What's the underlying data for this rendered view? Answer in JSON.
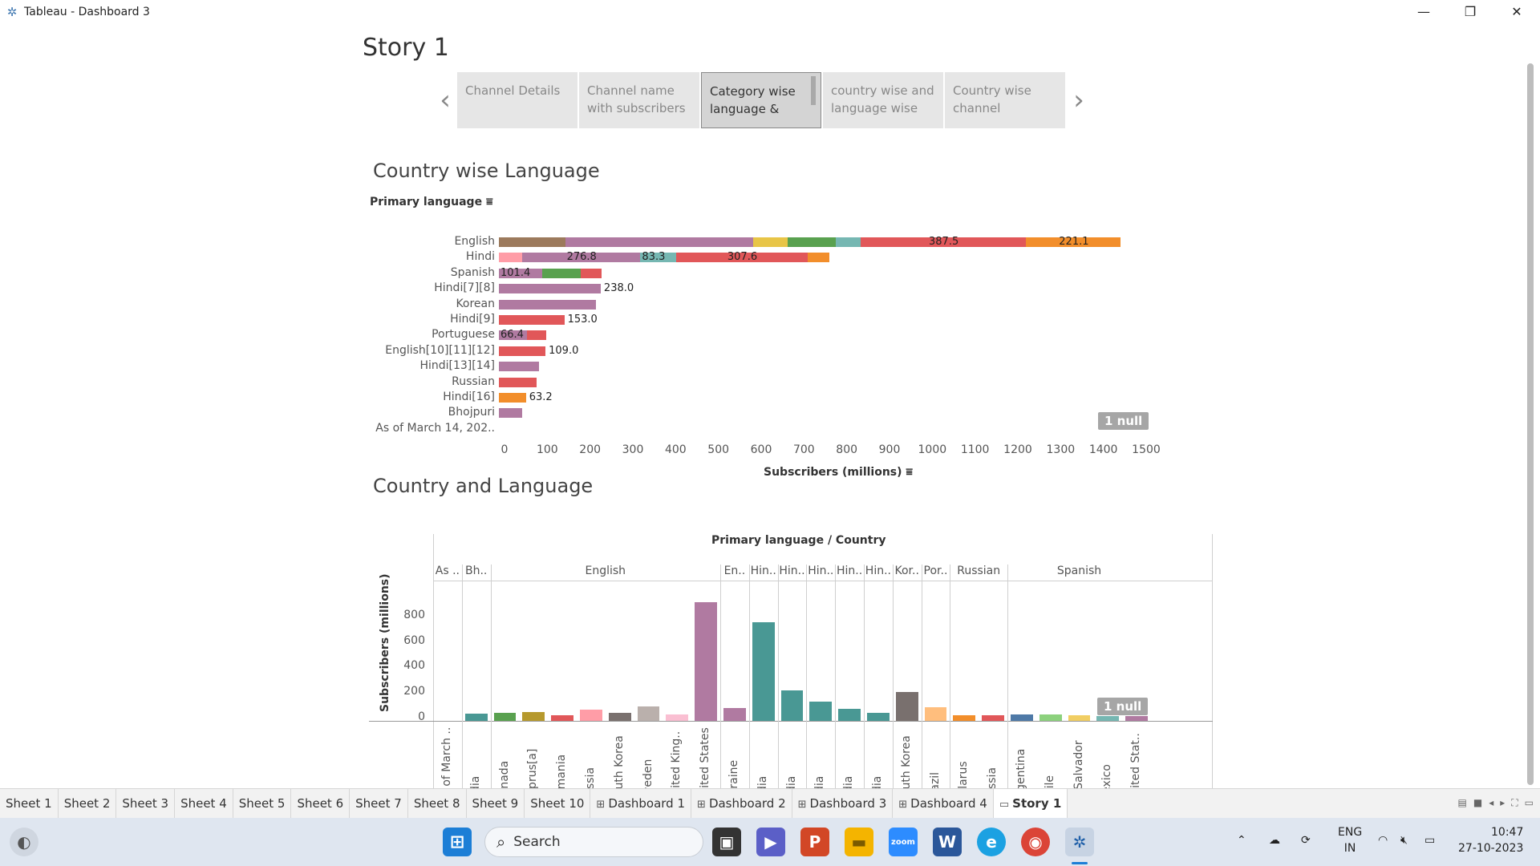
{
  "window": {
    "title": "Tableau - Dashboard 3",
    "minimize": "—",
    "maximize": "❐",
    "close": "✕"
  },
  "story": {
    "title": "Story 1",
    "points": [
      {
        "label": "Channel Details",
        "active": false
      },
      {
        "label": "Channel name with subscribers",
        "active": false
      },
      {
        "label": "Category wise language &",
        "active": true
      },
      {
        "label": "country wise and language wise",
        "active": false
      },
      {
        "label": "Country wise channel",
        "active": false
      }
    ]
  },
  "colors": {
    "brown": "#9c7a5c",
    "purple": "#b07aa1",
    "yellow": "#e8c547",
    "green": "#59a14f",
    "teal": "#76b7b2",
    "red": "#e15759",
    "orange": "#f28e2b",
    "pink": "#ff9da7",
    "dteal": "#499894",
    "gray": "#79706e",
    "lgray": "#bab0ac",
    "olive": "#b6992d",
    "lpink": "#fabfd2",
    "lorange": "#ffbe7d",
    "blue": "#4e79a7",
    "lgreen": "#8cd17d",
    "lyellow": "#f1ce63"
  },
  "chart_data": [
    {
      "type": "bar",
      "title": "Country wise Language",
      "ylabel": "Primary language",
      "xlabel": "Subscribers (millions)",
      "xlim": [
        0,
        1500
      ],
      "xticks": [
        0,
        100,
        200,
        300,
        400,
        500,
        600,
        700,
        800,
        900,
        1000,
        1100,
        1200,
        1300,
        1400,
        1500
      ],
      "null_badge": "1 null",
      "rows": [
        {
          "label": "English",
          "segments": [
            {
              "value": 155,
              "color": "brown"
            },
            {
              "value": 440,
              "color": "purple"
            },
            {
              "value": 80,
              "color": "yellow"
            },
            {
              "value": 112,
              "color": "green"
            },
            {
              "value": 58,
              "color": "teal"
            },
            {
              "value": 387.5,
              "color": "red",
              "label": "387.5"
            },
            {
              "value": 221.1,
              "color": "orange",
              "label": "221.1"
            }
          ]
        },
        {
          "label": "Hindi",
          "segments": [
            {
              "value": 54,
              "color": "pink"
            },
            {
              "value": 276.8,
              "color": "purple",
              "label": "276.8"
            },
            {
              "value": 83.3,
              "color": "teal",
              "label": "83.3"
            },
            {
              "value": 307.6,
              "color": "red",
              "label": "307.6"
            },
            {
              "value": 50,
              "color": "orange"
            }
          ]
        },
        {
          "label": "Spanish",
          "segments": [
            {
              "value": 101.4,
              "color": "purple",
              "label": "101.4"
            },
            {
              "value": 90,
              "color": "green"
            },
            {
              "value": 48,
              "color": "red"
            }
          ]
        },
        {
          "label": "Hindi[7][8]",
          "segments": [
            {
              "value": 238.0,
              "color": "purple"
            }
          ],
          "total_label": "238.0"
        },
        {
          "label": "Korean",
          "segments": [
            {
              "value": 226,
              "color": "purple"
            }
          ]
        },
        {
          "label": "Hindi[9]",
          "segments": [
            {
              "value": 153.0,
              "color": "red"
            }
          ],
          "total_label": "153.0"
        },
        {
          "label": "Portuguese",
          "segments": [
            {
              "value": 66.4,
              "color": "purple",
              "label": "66.4"
            },
            {
              "value": 44,
              "color": "red"
            }
          ]
        },
        {
          "label": "English[10][11][12]",
          "segments": [
            {
              "value": 109.0,
              "color": "red"
            }
          ],
          "total_label": "109.0"
        },
        {
          "label": "Hindi[13][14]",
          "segments": [
            {
              "value": 93,
              "color": "purple"
            }
          ]
        },
        {
          "label": "Russian",
          "segments": [
            {
              "value": 88,
              "color": "red"
            }
          ]
        },
        {
          "label": "Hindi[16]",
          "segments": [
            {
              "value": 63.2,
              "color": "orange"
            }
          ],
          "total_label": "63.2"
        },
        {
          "label": "Bhojpuri",
          "segments": [
            {
              "value": 54,
              "color": "purple"
            }
          ]
        },
        {
          "label": "As of March 14, 202..",
          "segments": []
        }
      ]
    },
    {
      "type": "bar",
      "title": "Country and Language",
      "header": "Primary language  /  Country",
      "ylabel": "Subscribers (millions)",
      "ylim": [
        0,
        900
      ],
      "yticks": [
        0,
        200,
        400,
        600,
        800
      ],
      "null_badge": "1 null",
      "groups": [
        {
          "label": "As ..",
          "countries": [
            {
              "name": "As of March ..",
              "value": 0,
              "color": "dteal"
            }
          ]
        },
        {
          "label": "Bh..",
          "countries": [
            {
              "name": "India",
              "value": 54,
              "color": "dteal"
            }
          ]
        },
        {
          "label": "English",
          "countries": [
            {
              "name": "Canada",
              "value": 65,
              "color": "green"
            },
            {
              "name": "Cyprus[a]",
              "value": 72,
              "color": "olive"
            },
            {
              "name": "Romania",
              "value": 47,
              "color": "red"
            },
            {
              "name": "Russia",
              "value": 88,
              "color": "pink"
            },
            {
              "name": "South Korea",
              "value": 60,
              "color": "gray"
            },
            {
              "name": "Sweden",
              "value": 111,
              "color": "lgray"
            },
            {
              "name": "United King..",
              "value": 48,
              "color": "lpink"
            },
            {
              "name": "United States",
              "value": 931,
              "color": "purple"
            }
          ]
        },
        {
          "label": "En..",
          "countries": [
            {
              "name": "Ukraine",
              "value": 100,
              "color": "purple"
            }
          ]
        },
        {
          "label": "Hin..",
          "countries": [
            {
              "name": "India",
              "value": 776,
              "color": "dteal"
            }
          ]
        },
        {
          "label": "Hin..",
          "countries": [
            {
              "name": "India",
              "value": 238,
              "color": "dteal"
            }
          ]
        },
        {
          "label": "Hin..",
          "countries": [
            {
              "name": "India",
              "value": 153,
              "color": "dteal"
            }
          ]
        },
        {
          "label": "Hin..",
          "countries": [
            {
              "name": "India",
              "value": 93,
              "color": "dteal"
            }
          ]
        },
        {
          "label": "Hin..",
          "countries": [
            {
              "name": "India",
              "value": 63,
              "color": "dteal"
            }
          ]
        },
        {
          "label": "Kor..",
          "countries": [
            {
              "name": "South Korea",
              "value": 226,
              "color": "gray"
            }
          ]
        },
        {
          "label": "Por..",
          "countries": [
            {
              "name": "Brazil",
              "value": 110,
              "color": "lorange"
            }
          ]
        },
        {
          "label": "Russian",
          "countries": [
            {
              "name": "Belarus",
              "value": 44,
              "color": "orange"
            },
            {
              "name": "Russia",
              "value": 44,
              "color": "red"
            }
          ]
        },
        {
          "label": "Spanish",
          "countries": [
            {
              "name": "Argentina",
              "value": 52,
              "color": "blue"
            },
            {
              "name": "Chile",
              "value": 48,
              "color": "lgreen"
            },
            {
              "name": "El Salvador",
              "value": 45,
              "color": "lyellow"
            },
            {
              "name": "Mexico",
              "value": 40,
              "color": "teal"
            },
            {
              "name": "United Stat..",
              "value": 38,
              "color": "purple"
            }
          ]
        }
      ]
    }
  ],
  "sheet_tabs": [
    {
      "label": "Sheet 1",
      "icon": ""
    },
    {
      "label": "Sheet 2",
      "icon": ""
    },
    {
      "label": "Sheet 3",
      "icon": ""
    },
    {
      "label": "Sheet 4",
      "icon": ""
    },
    {
      "label": "Sheet 5",
      "icon": ""
    },
    {
      "label": "Sheet 6",
      "icon": ""
    },
    {
      "label": "Sheet 7",
      "icon": ""
    },
    {
      "label": "Sheet 8",
      "icon": ""
    },
    {
      "label": "Sheet 9",
      "icon": ""
    },
    {
      "label": "Sheet 10",
      "icon": ""
    },
    {
      "label": "Dashboard 1",
      "icon": "⊞"
    },
    {
      "label": "Dashboard 2",
      "icon": "⊞"
    },
    {
      "label": "Dashboard 3",
      "icon": "⊞"
    },
    {
      "label": "Dashboard 4",
      "icon": "⊞"
    },
    {
      "label": "Story 1",
      "icon": "▭",
      "active": true
    }
  ],
  "taskbar": {
    "search_placeholder": "Search",
    "lang_top": "ENG",
    "lang_bottom": "IN",
    "time": "10:47",
    "date": "27-10-2023"
  }
}
